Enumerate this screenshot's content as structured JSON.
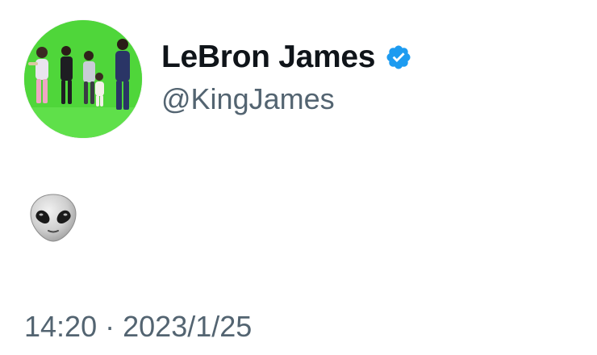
{
  "tweet": {
    "author": {
      "display_name": "LeBron James",
      "handle": "@KingJames",
      "verified": true,
      "avatar_description_icon": "profile-photo"
    },
    "body": {
      "emoji_icon": "alien-emoji"
    },
    "meta": {
      "time": "14:20",
      "separator": "·",
      "date": "2023/1/25"
    }
  },
  "colors": {
    "name": "#0f1419",
    "secondary_text": "#536471",
    "verified_blue": "#1d9bf0",
    "avatar_background_green": "#4fd63a"
  }
}
